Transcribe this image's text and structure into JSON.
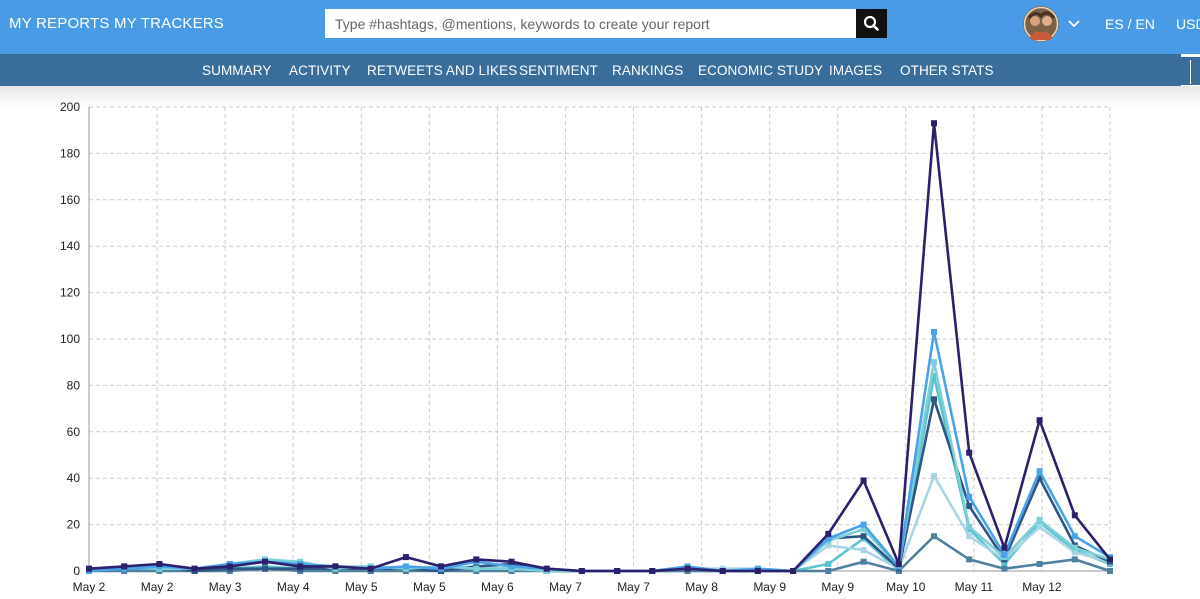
{
  "topbar": {
    "my_reports": "MY REPORTS",
    "my_trackers": "MY TRACKERS",
    "search_placeholder": "Type #hashtags, @mentions, keywords to create your report",
    "lang_es": "ES",
    "lang_sep": "/",
    "lang_en": "EN",
    "currency": "USD"
  },
  "subnav": {
    "items": [
      "SUMMARY",
      "ACTIVITY",
      "RETWEETS AND LIKES",
      "SENTIMENT",
      "RANKINGS",
      "ECONOMIC STUDY",
      "IMAGES",
      "OTHER STATS"
    ]
  },
  "colors": {
    "topbar": "#4a9be6",
    "subnav": "#3a6e9a",
    "grid": "#cccccc"
  },
  "icons": [
    "search-icon",
    "user-avatar",
    "chevron-down-icon"
  ],
  "chart_data": {
    "type": "line",
    "title": "",
    "xlabel": "",
    "ylabel": "",
    "ylim": [
      0,
      200
    ],
    "yticks": [
      0,
      20,
      40,
      60,
      80,
      100,
      120,
      140,
      160,
      180,
      200
    ],
    "x_tick_labels": [
      "May 2",
      "May 2",
      "May 3",
      "May 4",
      "May 5",
      "May 5",
      "May 6",
      "May 7",
      "May 7",
      "May 8",
      "May 9",
      "May 9",
      "May 10",
      "May 11",
      "May 12"
    ],
    "grid": true,
    "series": [
      {
        "color": "#2c1f6b",
        "values": [
          1,
          2,
          3,
          1,
          2,
          4,
          2,
          2,
          1,
          6,
          2,
          5,
          4,
          1,
          0,
          0,
          0,
          1,
          0,
          0,
          0,
          16,
          39,
          3,
          193,
          51,
          10,
          65,
          24,
          5
        ]
      },
      {
        "color": "#4aa3e8",
        "values": [
          0,
          1,
          2,
          1,
          3,
          4,
          3,
          2,
          1,
          2,
          1,
          4,
          2,
          1,
          0,
          0,
          0,
          2,
          0,
          1,
          0,
          14,
          20,
          2,
          103,
          32,
          7,
          43,
          15,
          6
        ]
      },
      {
        "color": "#7ccfd6",
        "values": [
          0,
          2,
          1,
          1,
          3,
          5,
          4,
          1,
          2,
          1,
          2,
          1,
          1,
          0,
          0,
          0,
          0,
          1,
          0,
          0,
          0,
          13,
          18,
          2,
          90,
          19,
          6,
          22,
          10,
          5
        ]
      },
      {
        "color": "#2f5585",
        "values": [
          0,
          1,
          2,
          0,
          1,
          1,
          1,
          1,
          1,
          1,
          0,
          2,
          3,
          0,
          0,
          0,
          0,
          1,
          0,
          0,
          0,
          14,
          15,
          1,
          74,
          28,
          5,
          40,
          11,
          4
        ]
      },
      {
        "color": "#a8d4e4",
        "values": [
          1,
          2,
          1,
          1,
          2,
          4,
          3,
          2,
          2,
          1,
          1,
          2,
          1,
          1,
          0,
          0,
          0,
          1,
          1,
          1,
          0,
          11,
          9,
          1,
          41,
          15,
          5,
          19,
          8,
          4
        ]
      },
      {
        "color": "#4f819e",
        "values": [
          0,
          0,
          0,
          0,
          0,
          1,
          0,
          0,
          0,
          0,
          0,
          0,
          0,
          0,
          0,
          0,
          0,
          0,
          0,
          0,
          0,
          0,
          4,
          0,
          15,
          5,
          1,
          3,
          5,
          0
        ]
      },
      {
        "color": "#5bc2cf",
        "values": [
          0,
          1,
          1,
          0,
          1,
          2,
          1,
          1,
          0,
          1,
          0,
          1,
          1,
          0,
          0,
          0,
          0,
          0,
          0,
          0,
          0,
          3,
          14,
          0,
          84,
          18,
          3,
          21,
          9,
          3
        ]
      }
    ]
  }
}
